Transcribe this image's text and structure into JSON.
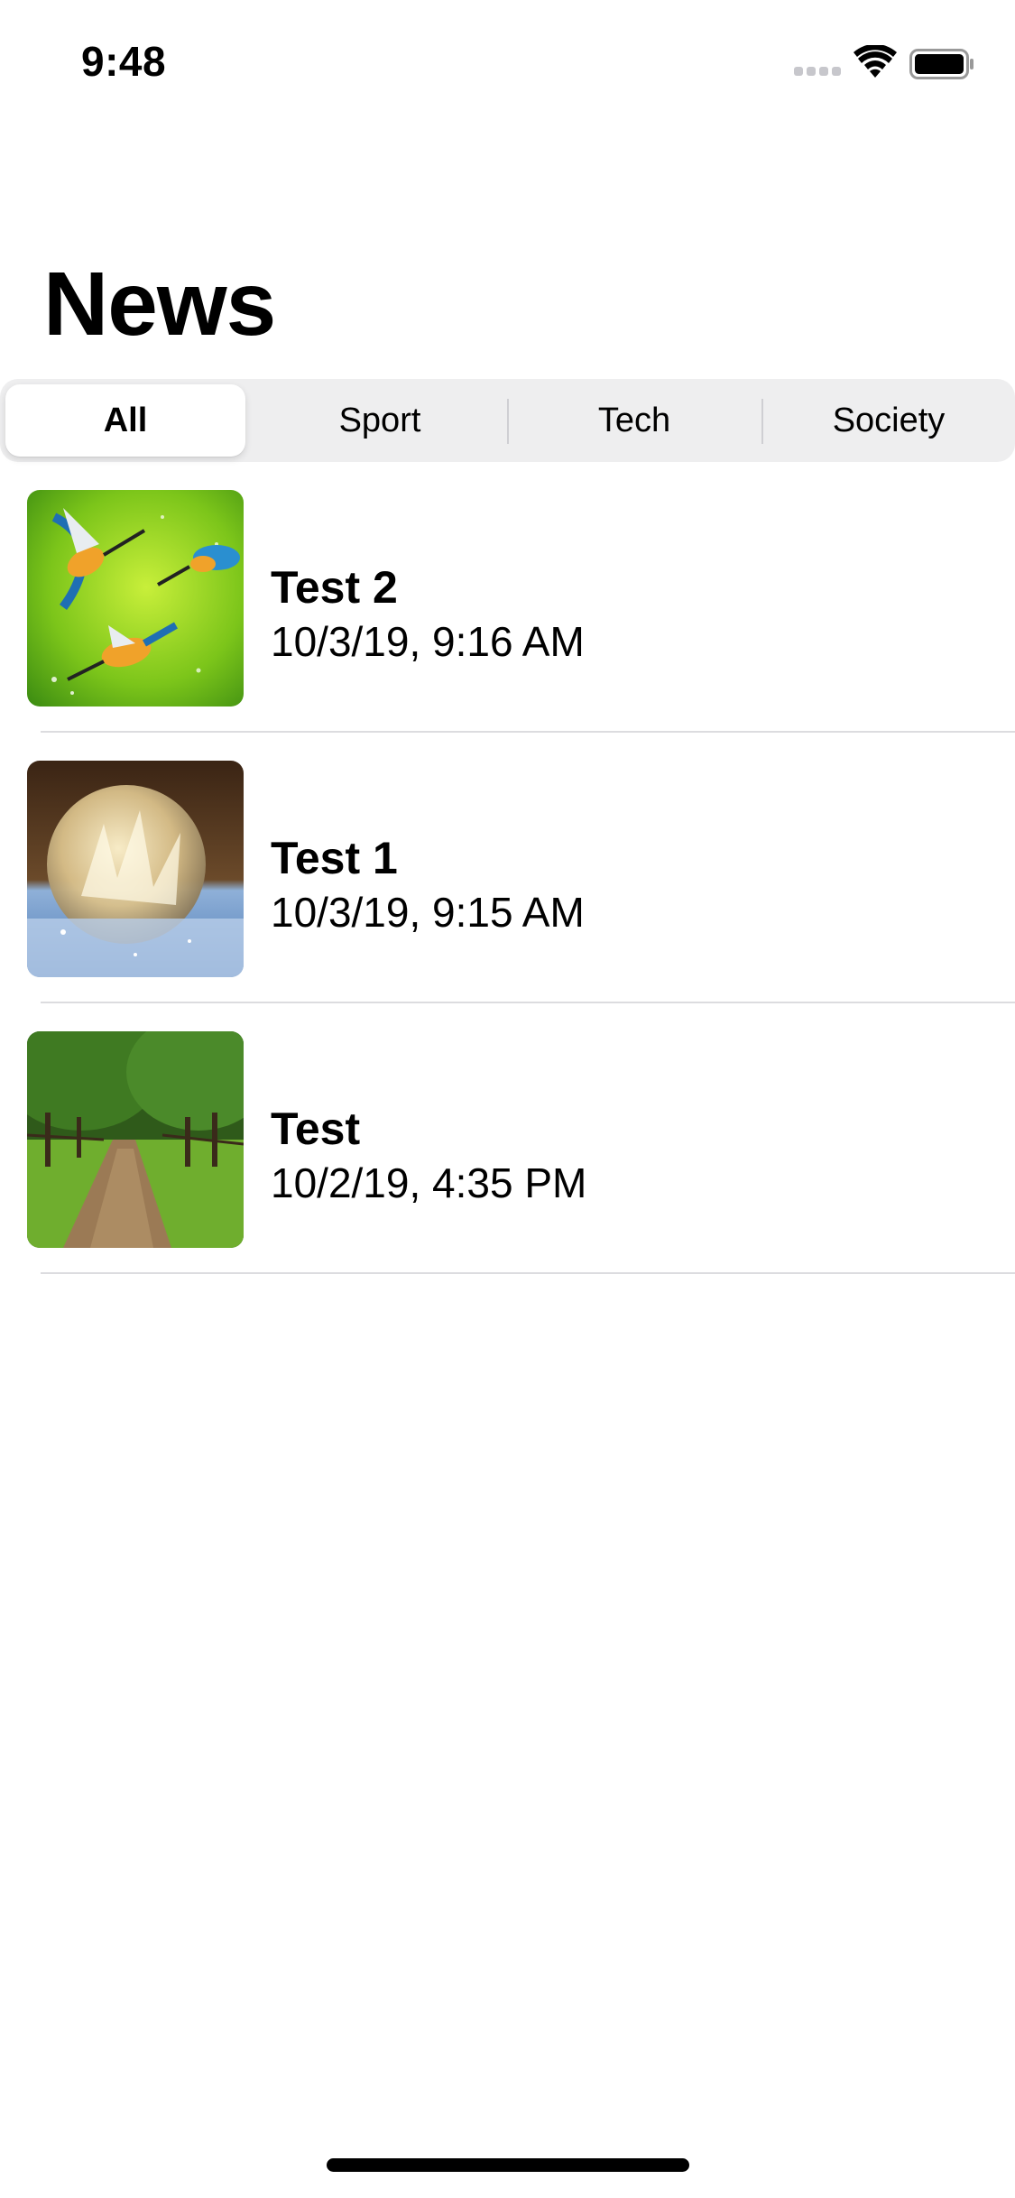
{
  "status_bar": {
    "time": "9:48"
  },
  "header": {
    "title": "News"
  },
  "segments": [
    {
      "label": "All",
      "selected": true
    },
    {
      "label": "Sport",
      "selected": false
    },
    {
      "label": "Tech",
      "selected": false
    },
    {
      "label": "Society",
      "selected": false
    }
  ],
  "news": [
    {
      "title": "Test 2",
      "date": "10/3/19, 9:16 AM",
      "image": "kingfishers-photo"
    },
    {
      "title": "Test 1",
      "date": "10/3/19, 9:15 AM",
      "image": "frozen-bubble-photo"
    },
    {
      "title": "Test",
      "date": "10/2/19, 4:35 PM",
      "image": "tree-lined-path-photo"
    }
  ],
  "icons": {
    "signal": "cellular-signal-icon",
    "wifi": "wifi-icon",
    "battery": "battery-icon"
  },
  "colors": {
    "background": "#ffffff",
    "segment_track": "#eeeeef",
    "separator": "#dcdcdf"
  }
}
